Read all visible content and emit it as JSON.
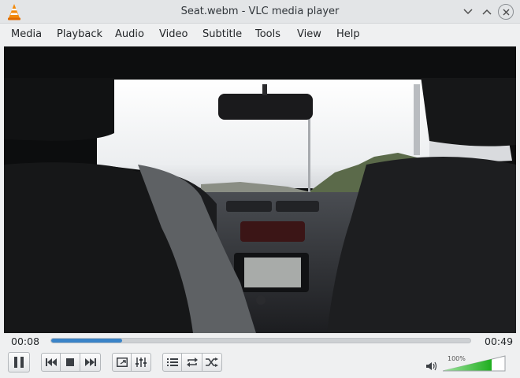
{
  "window": {
    "title": "Seat.webm - VLC media player"
  },
  "menu": [
    "Media",
    "Playback",
    "Audio",
    "Video",
    "Subtitle",
    "Tools",
    "View",
    "Help"
  ],
  "player": {
    "current_time": "00:08",
    "total_time": "00:49",
    "progress_fraction": 0.17,
    "volume_label": "100%",
    "volume_fraction": 1.0,
    "state": "playing"
  },
  "controls": {
    "play_pause_icon": "pause-icon",
    "prev_icon": "previous-icon",
    "stop_icon": "stop-icon",
    "next_icon": "next-icon",
    "fullscreen_icon": "fullscreen-icon",
    "extended_icon": "equalizer-icon",
    "playlist_icon": "playlist-icon",
    "loop_icon": "loop-icon",
    "random_icon": "shuffle-icon"
  },
  "colors": {
    "accent": "#3a84c8",
    "volume_green": "#2fbf2f"
  }
}
